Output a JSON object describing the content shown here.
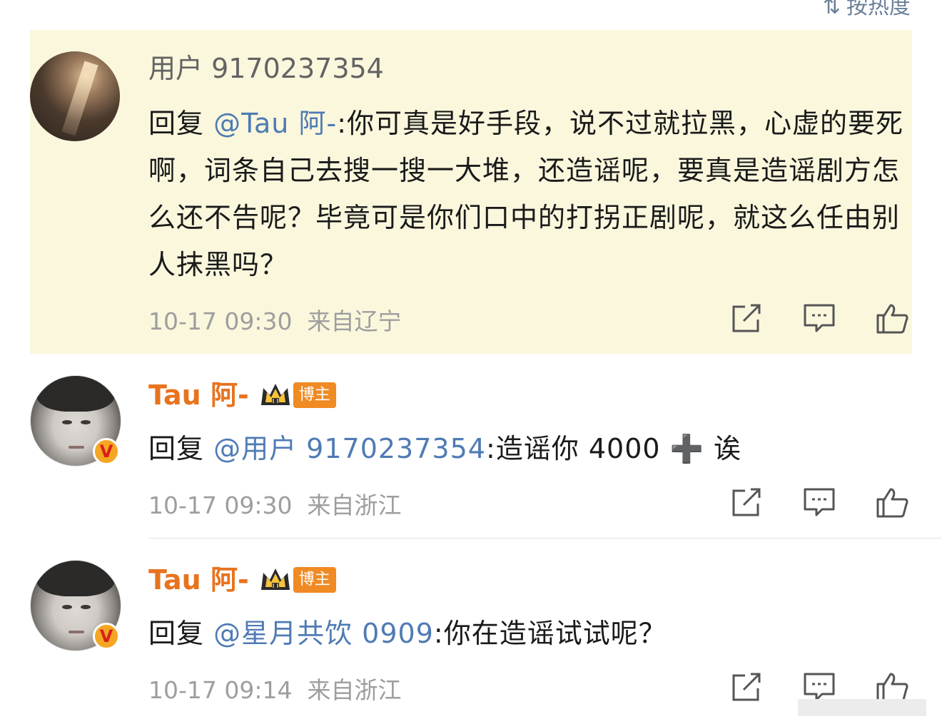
{
  "sort": {
    "label": "按热度",
    "icon": "sort-icon"
  },
  "comments": [
    {
      "username": "用户 9170237354",
      "reply_prefix": "回复 ",
      "mention": "@Tau 阿-",
      "text": ":你可真是好手段，说不过就拉黑，心虚的要死啊，词条自己去搜一搜一大堆，还造谣呢，要真是造谣剧方怎么还不告呢？毕竟可是你们口中的打拐正剧呢，就这么任由别人抹黑吗？",
      "time": "10-17 09:30",
      "location": "来自辽宁",
      "highlighted": true
    },
    {
      "username": "Tau 阿-",
      "badge": "博主",
      "verified_badge": "V",
      "reply_prefix": "回复 ",
      "mention": "@用户 9170237354",
      "text": ":造谣你 4000 ➕ 诶",
      "time": "10-17 09:30",
      "location": "来自浙江"
    },
    {
      "username": "Tau 阿-",
      "badge": "博主",
      "verified_badge": "V",
      "reply_prefix": "回复 ",
      "mention": "@星月共饮 0909",
      "text": ":你在造谣试试呢？",
      "time": "10-17 09:14",
      "location": "来自浙江"
    }
  ],
  "icons": {
    "share": "share-icon",
    "comment": "comment-icon",
    "like": "like-icon",
    "crown": "crown-icon"
  }
}
